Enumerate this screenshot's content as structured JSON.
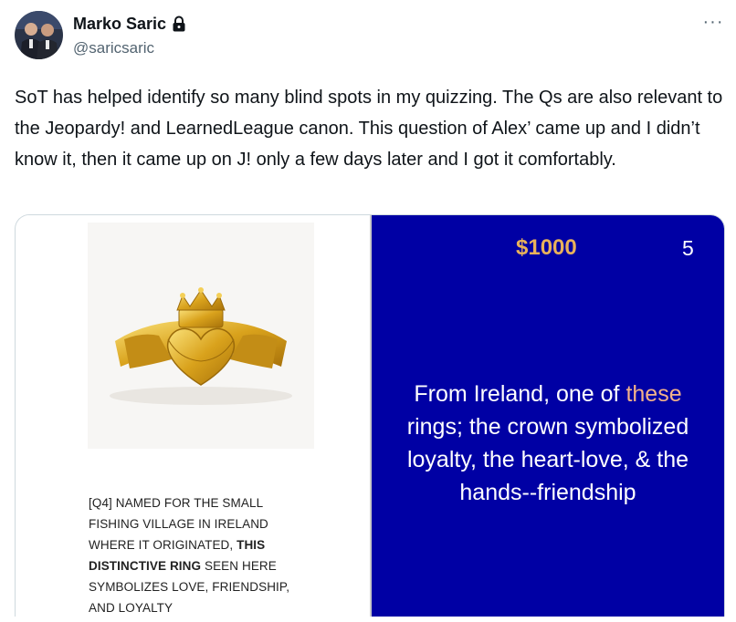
{
  "author": {
    "display_name": "Marko Saric",
    "handle": "@saricsaric",
    "locked_icon": "lock-icon"
  },
  "more_icon_text": "···",
  "tweet": {
    "text": "SoT has helped identify so many blind spots in my quizzing. The Qs are also relevant to the Jeopardy! and LearnedLeague canon. This question of Alex’ came up and I didn’t know it, then it came up on J! only a few days later and I got it comfortably."
  },
  "media": {
    "left": {
      "caption_part1": "[Q4] NAMED FOR THE SMALL FISHING VILLAGE IN IRELAND WHERE IT ORIGINATED, ",
      "caption_bold": "THIS DISTINCTIVE RING",
      "caption_part2": " SEEN HERE SYMBOLIZES LOVE, FRIENDSHIP, AND LOYALTY"
    },
    "right": {
      "amount": "$1000",
      "clue_number": "5",
      "clue_part1": "From Ireland, one of ",
      "clue_highlight": "these",
      "clue_part2": " rings; the crown symbolized loyalty, the heart-love, & the hands--friendship",
      "background_color": "#0000a4",
      "amount_color": "#e8b15b"
    }
  }
}
